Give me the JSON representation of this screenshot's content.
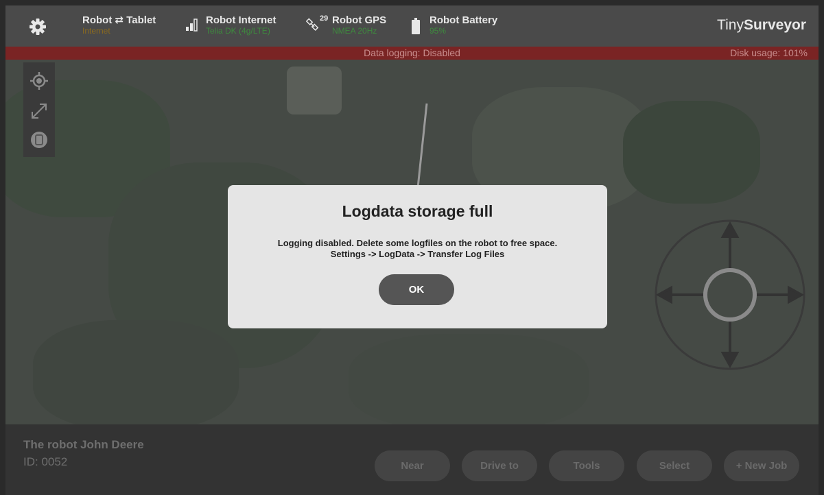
{
  "header": {
    "settings_icon": "gear-icon",
    "connection": {
      "title": "Robot ⇄ Tablet",
      "value": "Internet",
      "color": "#8a6a1f"
    },
    "internet": {
      "title": "Robot Internet",
      "value": "Telia DK (4g/LTE)",
      "color": "#3e8a3e",
      "icon": "signal-bars-icon"
    },
    "gps": {
      "title": "Robot GPS",
      "value": "NMEA 20Hz",
      "satellites": "29",
      "color": "#3e8a3e",
      "icon": "satellite-icon"
    },
    "battery": {
      "title": "Robot Battery",
      "value": "95%",
      "color": "#3e8a3e",
      "icon": "battery-icon"
    },
    "brand_light": "Tiny",
    "brand_bold": "Surveyor"
  },
  "banner": {
    "logging": "Data logging: Disabled",
    "disk": "Disk usage: 101%",
    "color": "#7a2424"
  },
  "map_tools": [
    {
      "name": "locate-icon"
    },
    {
      "name": "expand-icon"
    },
    {
      "name": "layers-icon"
    }
  ],
  "dialog": {
    "title": "Logdata storage full",
    "line1": "Logging disabled. Delete some logfiles on the robot to free space.",
    "line2": "Settings -> LogData -> Transfer Log Files",
    "ok_label": "OK"
  },
  "robot": {
    "name": "The robot John Deere",
    "id": "ID: 0052"
  },
  "actions": {
    "near": "Near",
    "drive_to": "Drive to",
    "tools": "Tools",
    "select": "Select",
    "new_job": "+ New Job"
  }
}
